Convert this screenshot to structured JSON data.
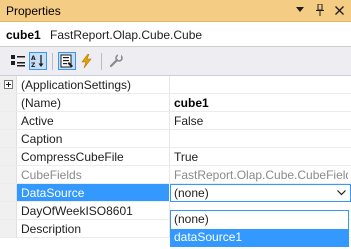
{
  "window": {
    "title": "Properties"
  },
  "object": {
    "name": "cube1",
    "type": "FastReport.Olap.Cube.Cube"
  },
  "toolbar": {
    "buttons": [
      {
        "icon": "categorized-icon",
        "active": false
      },
      {
        "icon": "alphabetical-icon",
        "active": true
      },
      {
        "icon": "properties-icon",
        "active": true
      },
      {
        "icon": "events-icon",
        "active": false
      },
      {
        "icon": "property-pages-icon",
        "active": false
      }
    ]
  },
  "properties": [
    {
      "name": "(ApplicationSettings)",
      "value": ""
    },
    {
      "name": "(Name)",
      "value": "cube1"
    },
    {
      "name": "Active",
      "value": "False"
    },
    {
      "name": "Caption",
      "value": ""
    },
    {
      "name": "CompressCubeFile",
      "value": "True"
    },
    {
      "name": "CubeFields",
      "value": "FastReport.Olap.Cube.CubeFields"
    },
    {
      "name": "DataSource",
      "value": "(none)"
    },
    {
      "name": "DayOfWeekISO8601",
      "value": ""
    },
    {
      "name": "Description",
      "value": ""
    }
  ],
  "dropdown": {
    "options": [
      "(none)",
      "dataSource1"
    ],
    "highlighted": "dataSource1"
  },
  "colors": {
    "accent": "#3399ff",
    "titlebar": "#f5cc84"
  }
}
